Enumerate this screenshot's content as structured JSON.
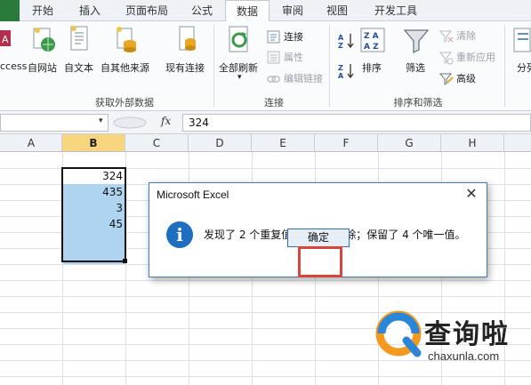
{
  "tabs": [
    {
      "label": "开始"
    },
    {
      "label": "插入"
    },
    {
      "label": "页面布局"
    },
    {
      "label": "公式"
    },
    {
      "label": "数据"
    },
    {
      "label": "审阅"
    },
    {
      "label": "视图"
    },
    {
      "label": "开发工具"
    }
  ],
  "ribbon": {
    "external_group": {
      "access": "ccess",
      "web": "自网站",
      "text": "自文本",
      "other": "自其他来源",
      "existing": "现有连接",
      "label": "获取外部数据"
    },
    "connections_group": {
      "refresh_all": "全部刷新",
      "connections": "连接",
      "properties": "属性",
      "edit_links": "编辑链接",
      "label": "连接"
    },
    "sort_group": {
      "sort": "排序",
      "filter": "筛选",
      "clear": "清除",
      "reapply": "重新应用",
      "advanced": "高级",
      "label": "排序和筛选"
    },
    "partial_right": "分列"
  },
  "formula_bar": {
    "fx": "fx",
    "value": "324"
  },
  "sheet": {
    "columns": [
      "A",
      "B",
      "C",
      "D",
      "E",
      "F",
      "G",
      "H"
    ],
    "selected_column": "B",
    "cells": [
      "324",
      "435",
      "3",
      "45"
    ]
  },
  "dialog": {
    "title": "Microsoft Excel",
    "close": "✕",
    "icon": "i",
    "message": "发现了 2 个重复值，已将其删除；保留了 4 个唯一值。",
    "ok": "确定"
  },
  "watermark": {
    "brand": "查询啦",
    "url": "chaxunla.com"
  },
  "colors": {
    "accent_file_tab": "#2a7a3c",
    "selection": "#aed4f0",
    "info_icon": "#1f6fc0",
    "highlight_box": "#d8453a",
    "watermark_orange": "#f39a1e",
    "watermark_blue": "#2a86d8"
  }
}
